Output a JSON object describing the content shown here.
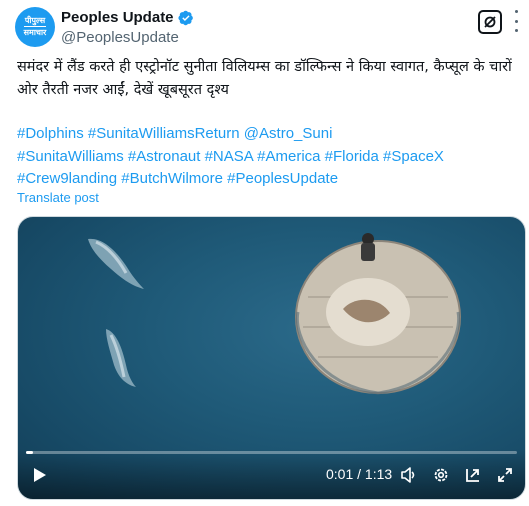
{
  "account": {
    "avatar_line1": "पीपुल्स",
    "avatar_line2": "समाचार",
    "display_name": "Peoples Update",
    "handle": "@PeoplesUpdate"
  },
  "tweet": {
    "text": "समंदर में लैंड करते ही एस्ट्रोनॉट सुनीता विलियम्स का डॉल्फिन्स ने किया स्वागत, कैप्सूल के चारों ओर तैरती नजर आईं, देखें खूबसूरत दृश्य",
    "hashtags": [
      "#Dolphins",
      "#SunitaWilliamsReturn",
      "@Astro_Suni",
      "#SunitaWilliams",
      "#Astronaut",
      "#NASA",
      "#America",
      "#Florida",
      "#SpaceX",
      "#Crew9landing",
      "#ButchWilmore",
      "#PeoplesUpdate"
    ],
    "translate_label": "Translate post"
  },
  "video": {
    "current_time": "0:01",
    "separator": "/",
    "duration": "1:13",
    "progress_fraction": 0.014
  },
  "colors": {
    "accent": "#1d9bf0",
    "text": "#0f1419",
    "muted": "#536471",
    "ocean": "#1f5a78"
  },
  "icons": {
    "verified": "verified-badge-icon",
    "grok": "grok-icon",
    "more": "more-icon",
    "play": "play-icon",
    "volume": "volume-icon",
    "settings": "gear-icon",
    "popout": "popout-icon",
    "fullscreen": "fullscreen-icon"
  }
}
